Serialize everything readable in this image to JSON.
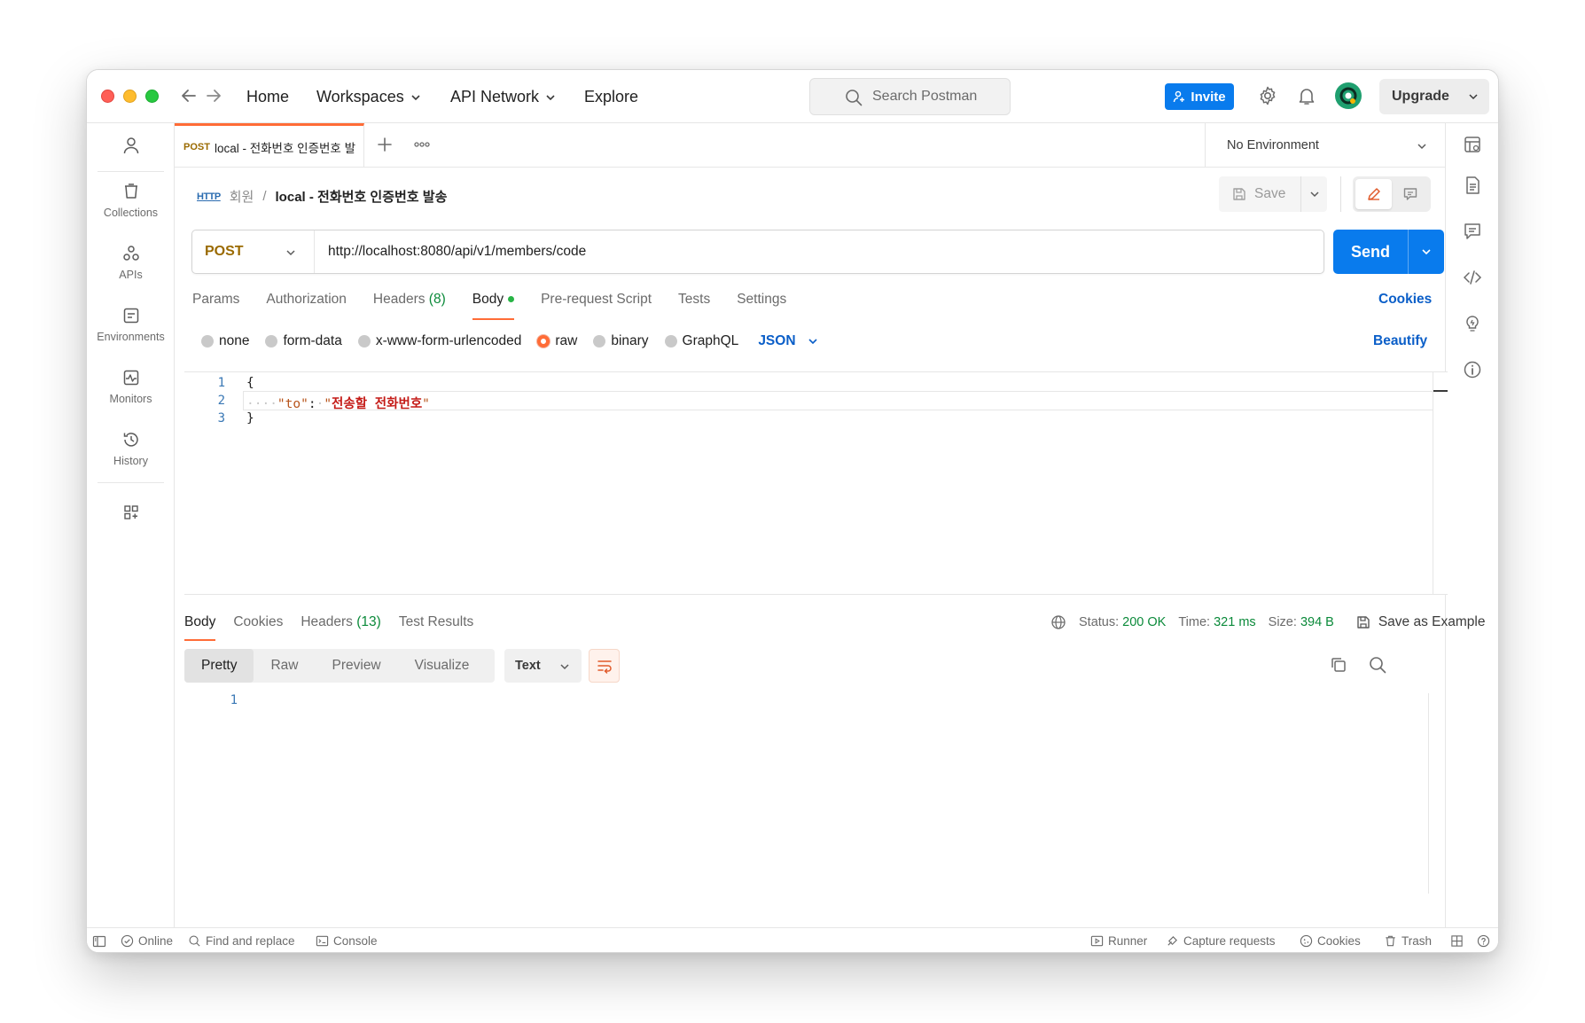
{
  "titlebar": {
    "nav": {
      "home": "Home",
      "workspaces": "Workspaces",
      "api_network": "API Network",
      "explore": "Explore"
    },
    "search_placeholder": "Search Postman",
    "invite_label": "Invite",
    "upgrade_label": "Upgrade"
  },
  "sidebar": {
    "items": [
      {
        "label": "Collections",
        "icon": "collections-icon"
      },
      {
        "label": "APIs",
        "icon": "apis-icon"
      },
      {
        "label": "Environments",
        "icon": "environments-icon"
      },
      {
        "label": "Monitors",
        "icon": "monitors-icon"
      },
      {
        "label": "History",
        "icon": "history-icon"
      }
    ]
  },
  "tab": {
    "method": "POST",
    "title": "local - 전화번호 인증번호 발"
  },
  "environment": {
    "selected": "No Environment"
  },
  "request": {
    "breadcrumb_badge": "HTTP",
    "breadcrumb_parent": "회원",
    "breadcrumb_sep": "/",
    "name": "local - 전화번호 인증번호 발송",
    "save_label": "Save",
    "method": "POST",
    "url": "http://localhost:8080/api/v1/members/code",
    "send_label": "Send",
    "tabs": {
      "params": "Params",
      "authorization": "Authorization",
      "headers": "Headers",
      "headers_count": "(8)",
      "body": "Body",
      "prerequest": "Pre-request Script",
      "tests": "Tests",
      "settings": "Settings"
    },
    "cookies_label": "Cookies",
    "body_types": [
      "none",
      "form-data",
      "x-www-form-urlencoded",
      "raw",
      "binary",
      "GraphQL"
    ],
    "body_type_selected": "raw",
    "format": "JSON",
    "beautify_label": "Beautify",
    "code": {
      "line_numbers": [
        "1",
        "2",
        "3"
      ],
      "open_brace": "{",
      "indent": "····",
      "key": "\"to\"",
      "colon": ":",
      "space": "·",
      "quote": "\"",
      "value": "전송할 전화번호",
      "close_brace": "}"
    }
  },
  "response": {
    "tabs": {
      "body": "Body",
      "cookies": "Cookies",
      "headers": "Headers",
      "headers_count": "(13)",
      "test_results": "Test Results"
    },
    "status_label": "Status:",
    "status_value": "200 OK",
    "time_label": "Time:",
    "time_value": "321 ms",
    "size_label": "Size:",
    "size_value": "394 B",
    "save_example_label": "Save as Example",
    "views": [
      "Pretty",
      "Raw",
      "Preview",
      "Visualize"
    ],
    "view_selected": "Pretty",
    "text_format": "Text",
    "line_numbers": [
      "1"
    ]
  },
  "statusbar": {
    "online": "Online",
    "find_replace": "Find and replace",
    "console": "Console",
    "runner": "Runner",
    "capture": "Capture requests",
    "cookies": "Cookies",
    "trash": "Trash"
  },
  "colors": {
    "accent_orange": "#ff6c37",
    "primary_blue": "#097bed",
    "link_blue": "#0a5ec8",
    "success_green": "#0b8a3a",
    "method_post": "#9a6a00"
  }
}
